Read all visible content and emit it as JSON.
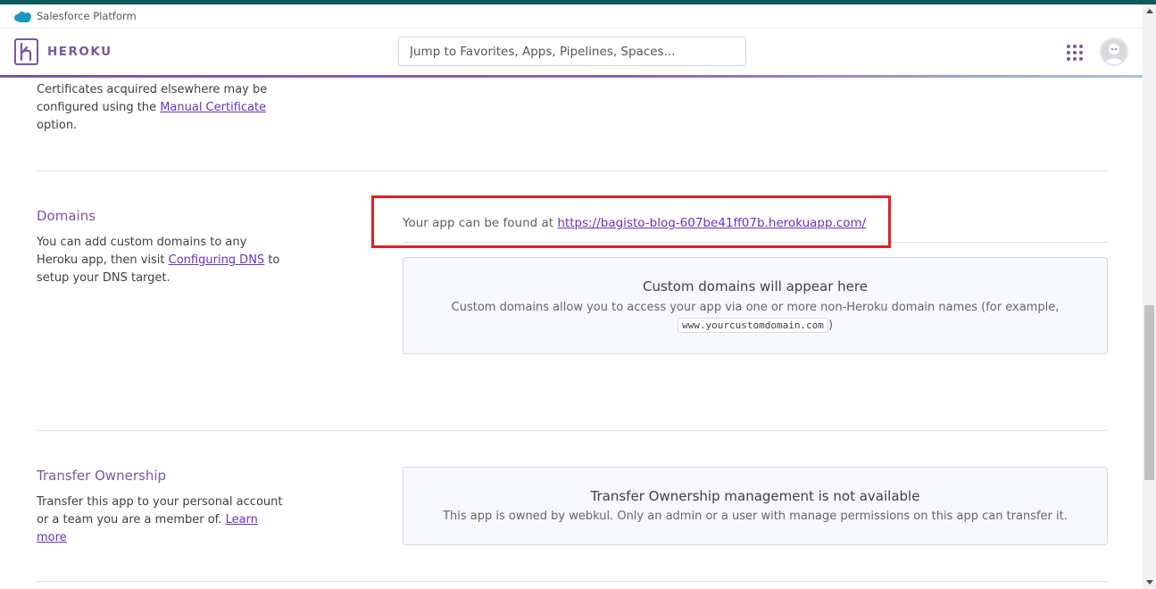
{
  "salesforce_bar": {
    "title": "Salesforce Platform"
  },
  "header": {
    "brand": "HEROKU",
    "search_placeholder": "Jump to Favorites, Apps, Pipelines, Spaces...",
    "apps_icon": "grid-icon",
    "avatar_icon": "avatar-icon"
  },
  "certificates": {
    "desc_before": "Certificates acquired elsewhere may be configured using the ",
    "link": "Manual Certificate",
    "desc_after": " option."
  },
  "domains": {
    "title": "Domains",
    "desc_before": "You can add custom domains to any Heroku app, then visit ",
    "link": "Configuring DNS",
    "desc_after": " to setup your DNS target.",
    "found_prefix": "Your app can be found at ",
    "app_url": "https://bagisto-blog-607be41ff07b.herokuapp.com/",
    "empty_title": "Custom domains will appear here",
    "empty_desc": "Custom domains allow you to access your app via one or more non-Heroku domain names (for example,",
    "example_domain": "www.yourcustomdomain.com",
    "example_close": ")"
  },
  "transfer": {
    "title": "Transfer Ownership",
    "desc_before": "Transfer this app to your personal account or a team you are a member of. ",
    "link": "Learn more",
    "panel_title": "Transfer Ownership management is not available",
    "panel_desc": "This app is owned by webkul. Only an admin or a user with manage permissions on this app can transfer it."
  },
  "colors": {
    "brand_purple": "#79589f",
    "link": "#6733c4",
    "highlight": "#e21f25",
    "top_stripe": "#0e5a5e"
  }
}
